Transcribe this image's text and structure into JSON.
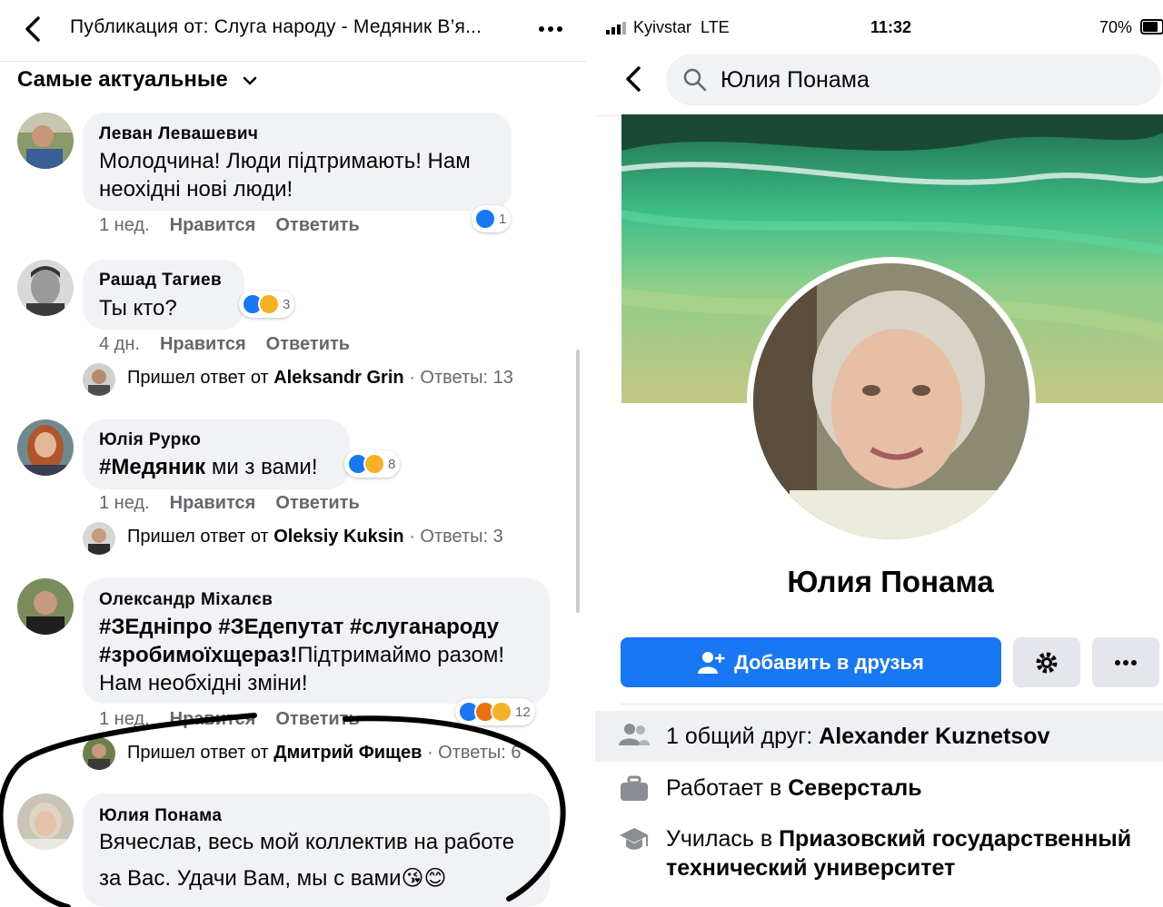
{
  "left": {
    "header_title": "Публикация от: Слуга народу - Медяник В’я...",
    "sort_label": "Самые актуальные",
    "like_label": "Нравится",
    "reply_label": "Ответить",
    "comments": [
      {
        "author": "Леван Левашевич",
        "text_line1": "Молодчина! Люди підтримають! Нам",
        "text_line2": "неохідні нові люди!",
        "time": "1 нед.",
        "reaction_count": "1"
      },
      {
        "author": "Рашад Тагиев",
        "text_line1": "Ты кто?",
        "time": "4 дн.",
        "reaction_count": "3",
        "reply_prefix": "Пришел ответ от",
        "reply_author": "Aleksandr Grin",
        "reply_count": "· Ответы: 13"
      },
      {
        "author": "Юлія Рурко",
        "text_hashtag": "#Медяник",
        "text_rest": " ми з вами!",
        "time": "1 нед.",
        "reaction_count": "8",
        "reply_prefix": "Пришел ответ от",
        "reply_author": "Oleksiy Kuksin",
        "reply_count": "· Ответы: 3"
      },
      {
        "author": "Олександр Міхалєв",
        "text_line1": "#ЗЕдніпро #ЗЕдепутат #слуганароду",
        "text_line2_bold": "#зробимоїхщераз!",
        "text_line2_rest": "Підтримаймо разом!",
        "text_line3": "Нам необхідні зміни!",
        "time": "1 нед.",
        "reaction_count": "12",
        "reply_prefix": "Пришел ответ от",
        "reply_author": "Дмитрий Фищев",
        "reply_count": "· Ответы: 6"
      },
      {
        "author": "Юлия Понама",
        "text_line1": "Вячеслав, весь мой коллектив на работе",
        "text_line2": "за Вас. Удачи Вам, мы с вами",
        "emoji": "😘😊"
      }
    ]
  },
  "right": {
    "status": {
      "carrier": "Kyivstar  LTE",
      "time": "11:32",
      "battery": "70%"
    },
    "search": {
      "value": "Юлия Понама"
    },
    "profile_name": "Юлия Понама",
    "add_friend_label": "Добавить в друзья",
    "info": {
      "mutual_prefix": "1 общий друг:",
      "mutual_name": "Alexander Kuznetsov",
      "work_prefix": "Работает в",
      "work_place": "Северсталь",
      "study_prefix": "Училась в",
      "study_place_line1": "Приазовский государственный",
      "study_place_line2": "технический университет"
    }
  },
  "colors": {
    "facebook_blue": "#1877f2",
    "bubble_gray": "#f0f2f5",
    "meta_gray": "#65676b",
    "like_blue": "#1877f2",
    "haha_yellow": "#f7b125",
    "angry_orange": "#e9710f"
  },
  "icons": {
    "back": "chevron-left-icon",
    "more": "more-horizontal-icon",
    "sort_chevron": "chevron-down-icon",
    "search": "search-icon",
    "add_friend": "add-friend-icon",
    "settings": "gear-icon",
    "mutual_friends": "friends-icon",
    "work": "briefcase-icon",
    "education": "graduation-cap-icon"
  }
}
